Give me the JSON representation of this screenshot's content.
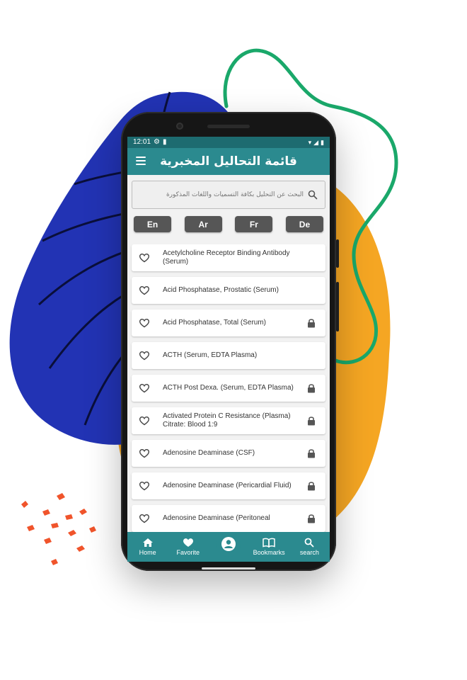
{
  "status": {
    "time": "12:01"
  },
  "header": {
    "title": "قائمة التحاليل المخبرية"
  },
  "search": {
    "placeholder": "البحث عن التحليل بكافة التسميات واللغات المذكورة"
  },
  "languages": [
    "En",
    "Ar",
    "Fr",
    "De"
  ],
  "tests": [
    {
      "name": "Acetylcholine Receptor Binding Antibody (Serum)",
      "locked": false
    },
    {
      "name": "Acid Phosphatase, Prostatic (Serum)",
      "locked": false
    },
    {
      "name": "Acid Phosphatase, Total (Serum)",
      "locked": true
    },
    {
      "name": "ACTH (Serum, EDTA Plasma)",
      "locked": false
    },
    {
      "name": "ACTH Post Dexa. (Serum, EDTA Plasma)",
      "locked": true
    },
    {
      "name": "Activated Protein C Resistance (Plasma) Citrate: Blood 1:9",
      "locked": true
    },
    {
      "name": "Adenosine Deaminase (CSF)",
      "locked": true
    },
    {
      "name": "Adenosine Deaminase (Pericardial Fluid)",
      "locked": true
    },
    {
      "name": "Adenosine Deaminase (Peritoneal",
      "locked": true
    }
  ],
  "nav": {
    "home": "Home",
    "favorite": "Favorite",
    "bookmarks": "Bookmarks",
    "search": "search"
  },
  "colors": {
    "primary": "#2b8a8f",
    "status_bar": "#1d6b70",
    "blob_blue": "#2233b4",
    "blob_orange": "#f5a623",
    "ribbon_green": "#1aa86a",
    "confetti": "#f0542b"
  }
}
